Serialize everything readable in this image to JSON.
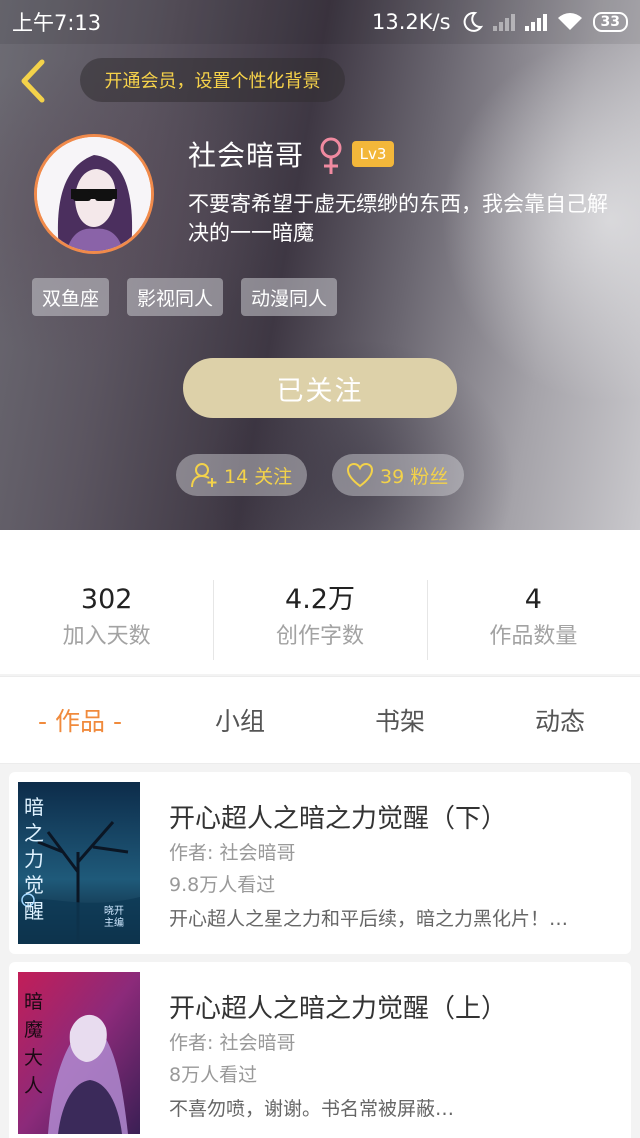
{
  "status_bar": {
    "time": "上午7:13",
    "network_speed": "13.2K/s",
    "battery": "33",
    "icons": [
      "moon-icon",
      "signal-icon",
      "signal-icon",
      "wifi-icon",
      "battery-icon"
    ]
  },
  "header": {
    "back_icon": "chevron-left-icon",
    "vip_prompt": "开通会员，设置个性化背景"
  },
  "profile": {
    "username": "社会暗哥",
    "gender_icon": "female-icon",
    "level": "Lv3",
    "signature": "不要寄希望于虚无缥缈的东西，我会靠自己解决的一一暗魔",
    "tags": [
      "双鱼座",
      "影视同人",
      "动漫同人"
    ],
    "follow_button": "已关注",
    "following": "14 关注",
    "followers": "39 粉丝",
    "colors": {
      "accent": "#f08a3c",
      "gold": "#f3d24a",
      "level_badge": "#f3b73a",
      "follow_button": "#ddd1a9"
    }
  },
  "stats": [
    {
      "value": "302",
      "label": "加入天数"
    },
    {
      "value": "4.2万",
      "label": "创作字数"
    },
    {
      "value": "4",
      "label": "作品数量"
    }
  ],
  "tabs": [
    {
      "label": "- 作品 -",
      "active": true
    },
    {
      "label": "小组",
      "active": false
    },
    {
      "label": "书架",
      "active": false
    },
    {
      "label": "动态",
      "active": false
    }
  ],
  "works": [
    {
      "title": "开心超人之暗之力觉醒（下）",
      "author": "作者: 社会暗哥",
      "views": "9.8万人看过",
      "description": "开心超人之星之力和平后续，暗之力黑化片！…",
      "cover_text": "暗之力觉醒",
      "cover_sub": "晓开 主编"
    },
    {
      "title": "开心超人之暗之力觉醒（上）",
      "author": "作者: 社会暗哥",
      "views": "8万人看过",
      "description": "不喜勿喷，谢谢。书名常被屏蔽…",
      "cover_text": "暗魔大人"
    }
  ]
}
